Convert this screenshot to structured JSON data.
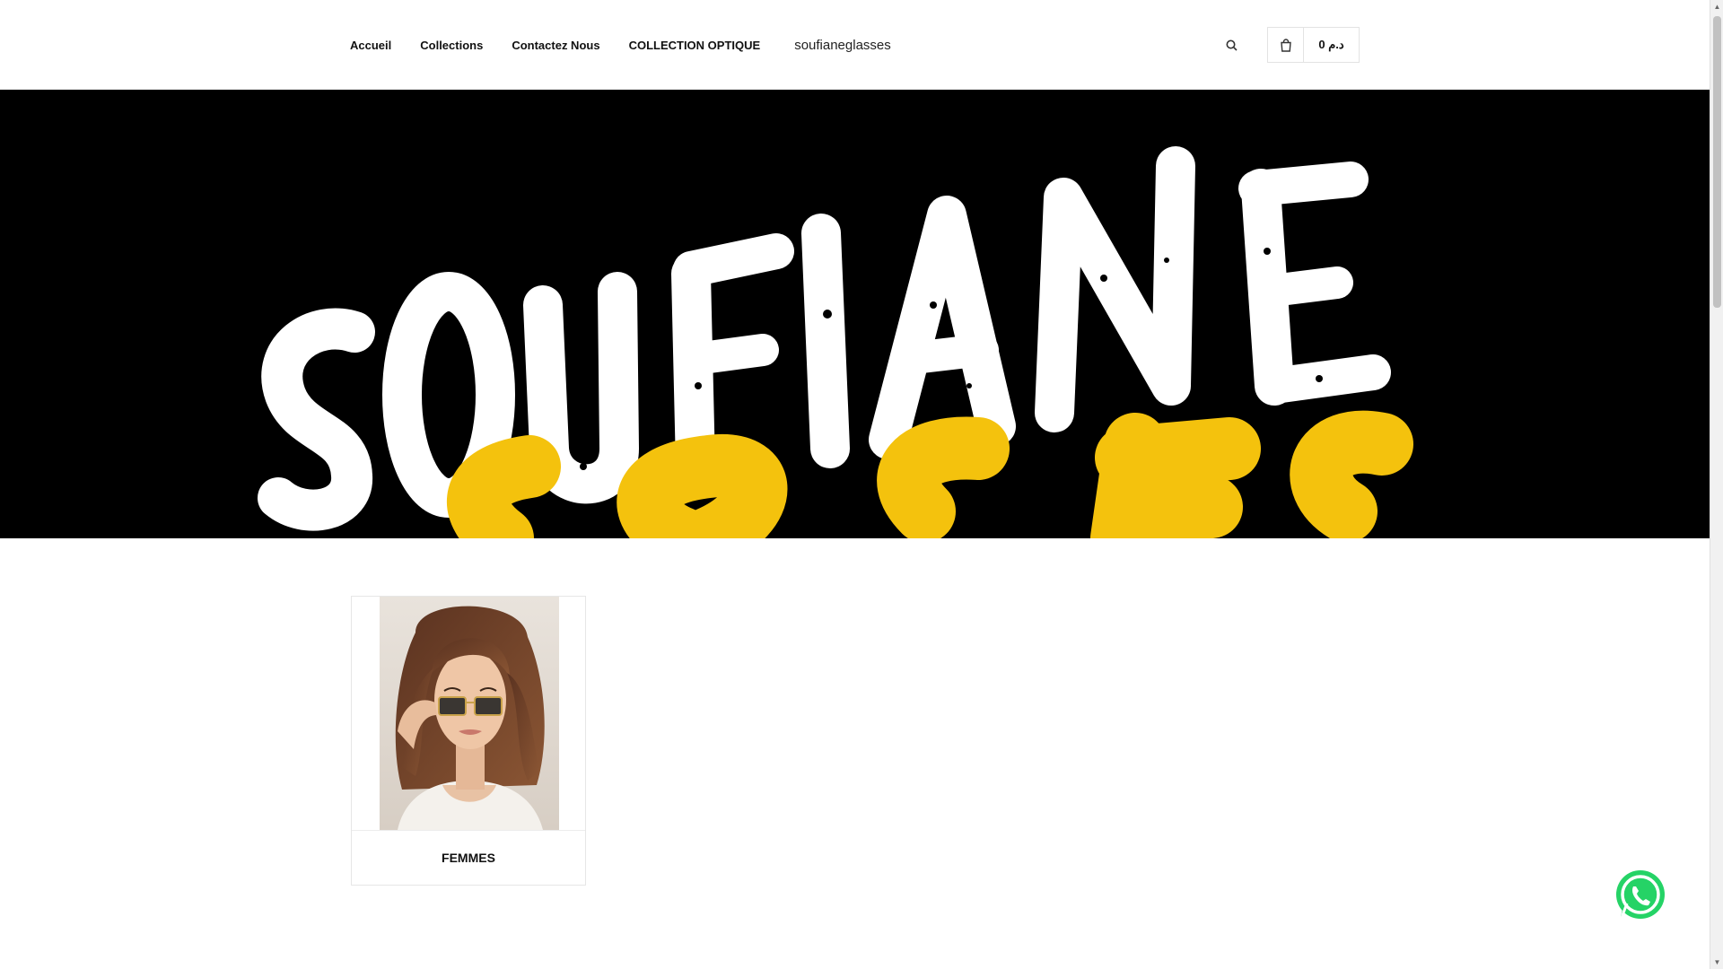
{
  "header": {
    "nav": [
      {
        "label": "Accueil"
      },
      {
        "label": "Collections"
      },
      {
        "label": "Contactez Nous"
      },
      {
        "label": "COLLECTION OPTIQUE"
      }
    ],
    "brand": "soufianeglasses",
    "search_icon": "search-icon",
    "cart": {
      "icon": "cart-icon",
      "total": "0 د.م"
    }
  },
  "hero": {
    "logo_text": "SOUFIANE GLASSES",
    "colors": {
      "background": "#000000",
      "primary_text": "#ffffff",
      "accent_text": "#f4c20d"
    }
  },
  "collections": [
    {
      "title": "FEMMES",
      "image": "woman wearing sunglasses"
    }
  ],
  "floating": {
    "whatsapp_icon": "whatsapp-icon",
    "color": "#25d366"
  }
}
